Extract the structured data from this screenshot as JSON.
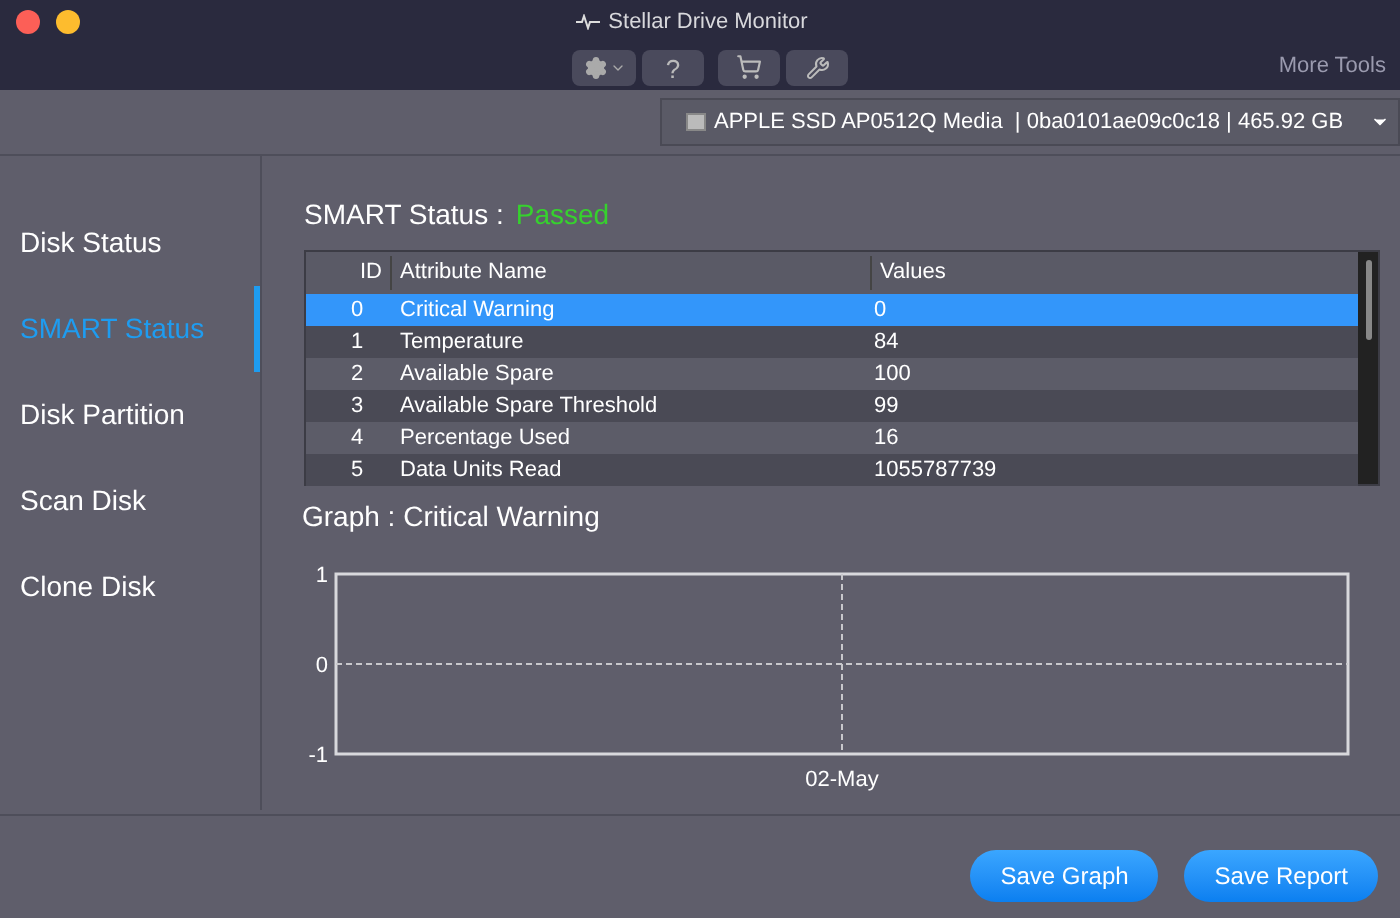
{
  "window": {
    "title": "Stellar Drive Monitor"
  },
  "toolbar": {
    "help_label": "?",
    "more_tools": "More Tools"
  },
  "drive_selector": {
    "value": "APPLE SSD AP0512Q Media  | 0ba0101ae09c0c18 | 465.92 GB"
  },
  "sidebar": {
    "items": [
      {
        "label": "Disk Status",
        "selected": false
      },
      {
        "label": "SMART Status",
        "selected": true
      },
      {
        "label": "Disk Partition",
        "selected": false
      },
      {
        "label": "Scan Disk",
        "selected": false
      },
      {
        "label": "Clone Disk",
        "selected": false
      }
    ]
  },
  "smart_status": {
    "label": "SMART Status :",
    "value": "Passed"
  },
  "table": {
    "columns": [
      "ID",
      "Attribute Name",
      "Values"
    ],
    "rows": [
      {
        "id": "0",
        "name": "Critical Warning",
        "value": "0",
        "selected": true
      },
      {
        "id": "1",
        "name": "Temperature",
        "value": "84",
        "selected": false
      },
      {
        "id": "2",
        "name": "Available Spare",
        "value": "100",
        "selected": false
      },
      {
        "id": "3",
        "name": "Available Spare Threshold",
        "value": "99",
        "selected": false
      },
      {
        "id": "4",
        "name": "Percentage Used",
        "value": "16",
        "selected": false
      },
      {
        "id": "5",
        "name": "Data Units Read",
        "value": "1055787739",
        "selected": false
      }
    ]
  },
  "graph": {
    "title": "Graph : Critical Warning",
    "chart_data": {
      "type": "line",
      "categories": [
        "02-May"
      ],
      "ylim": [
        -1,
        1
      ],
      "yticks": [
        -1,
        0,
        1
      ]
    }
  },
  "buttons": [
    "Save Graph",
    "Save Report"
  ]
}
